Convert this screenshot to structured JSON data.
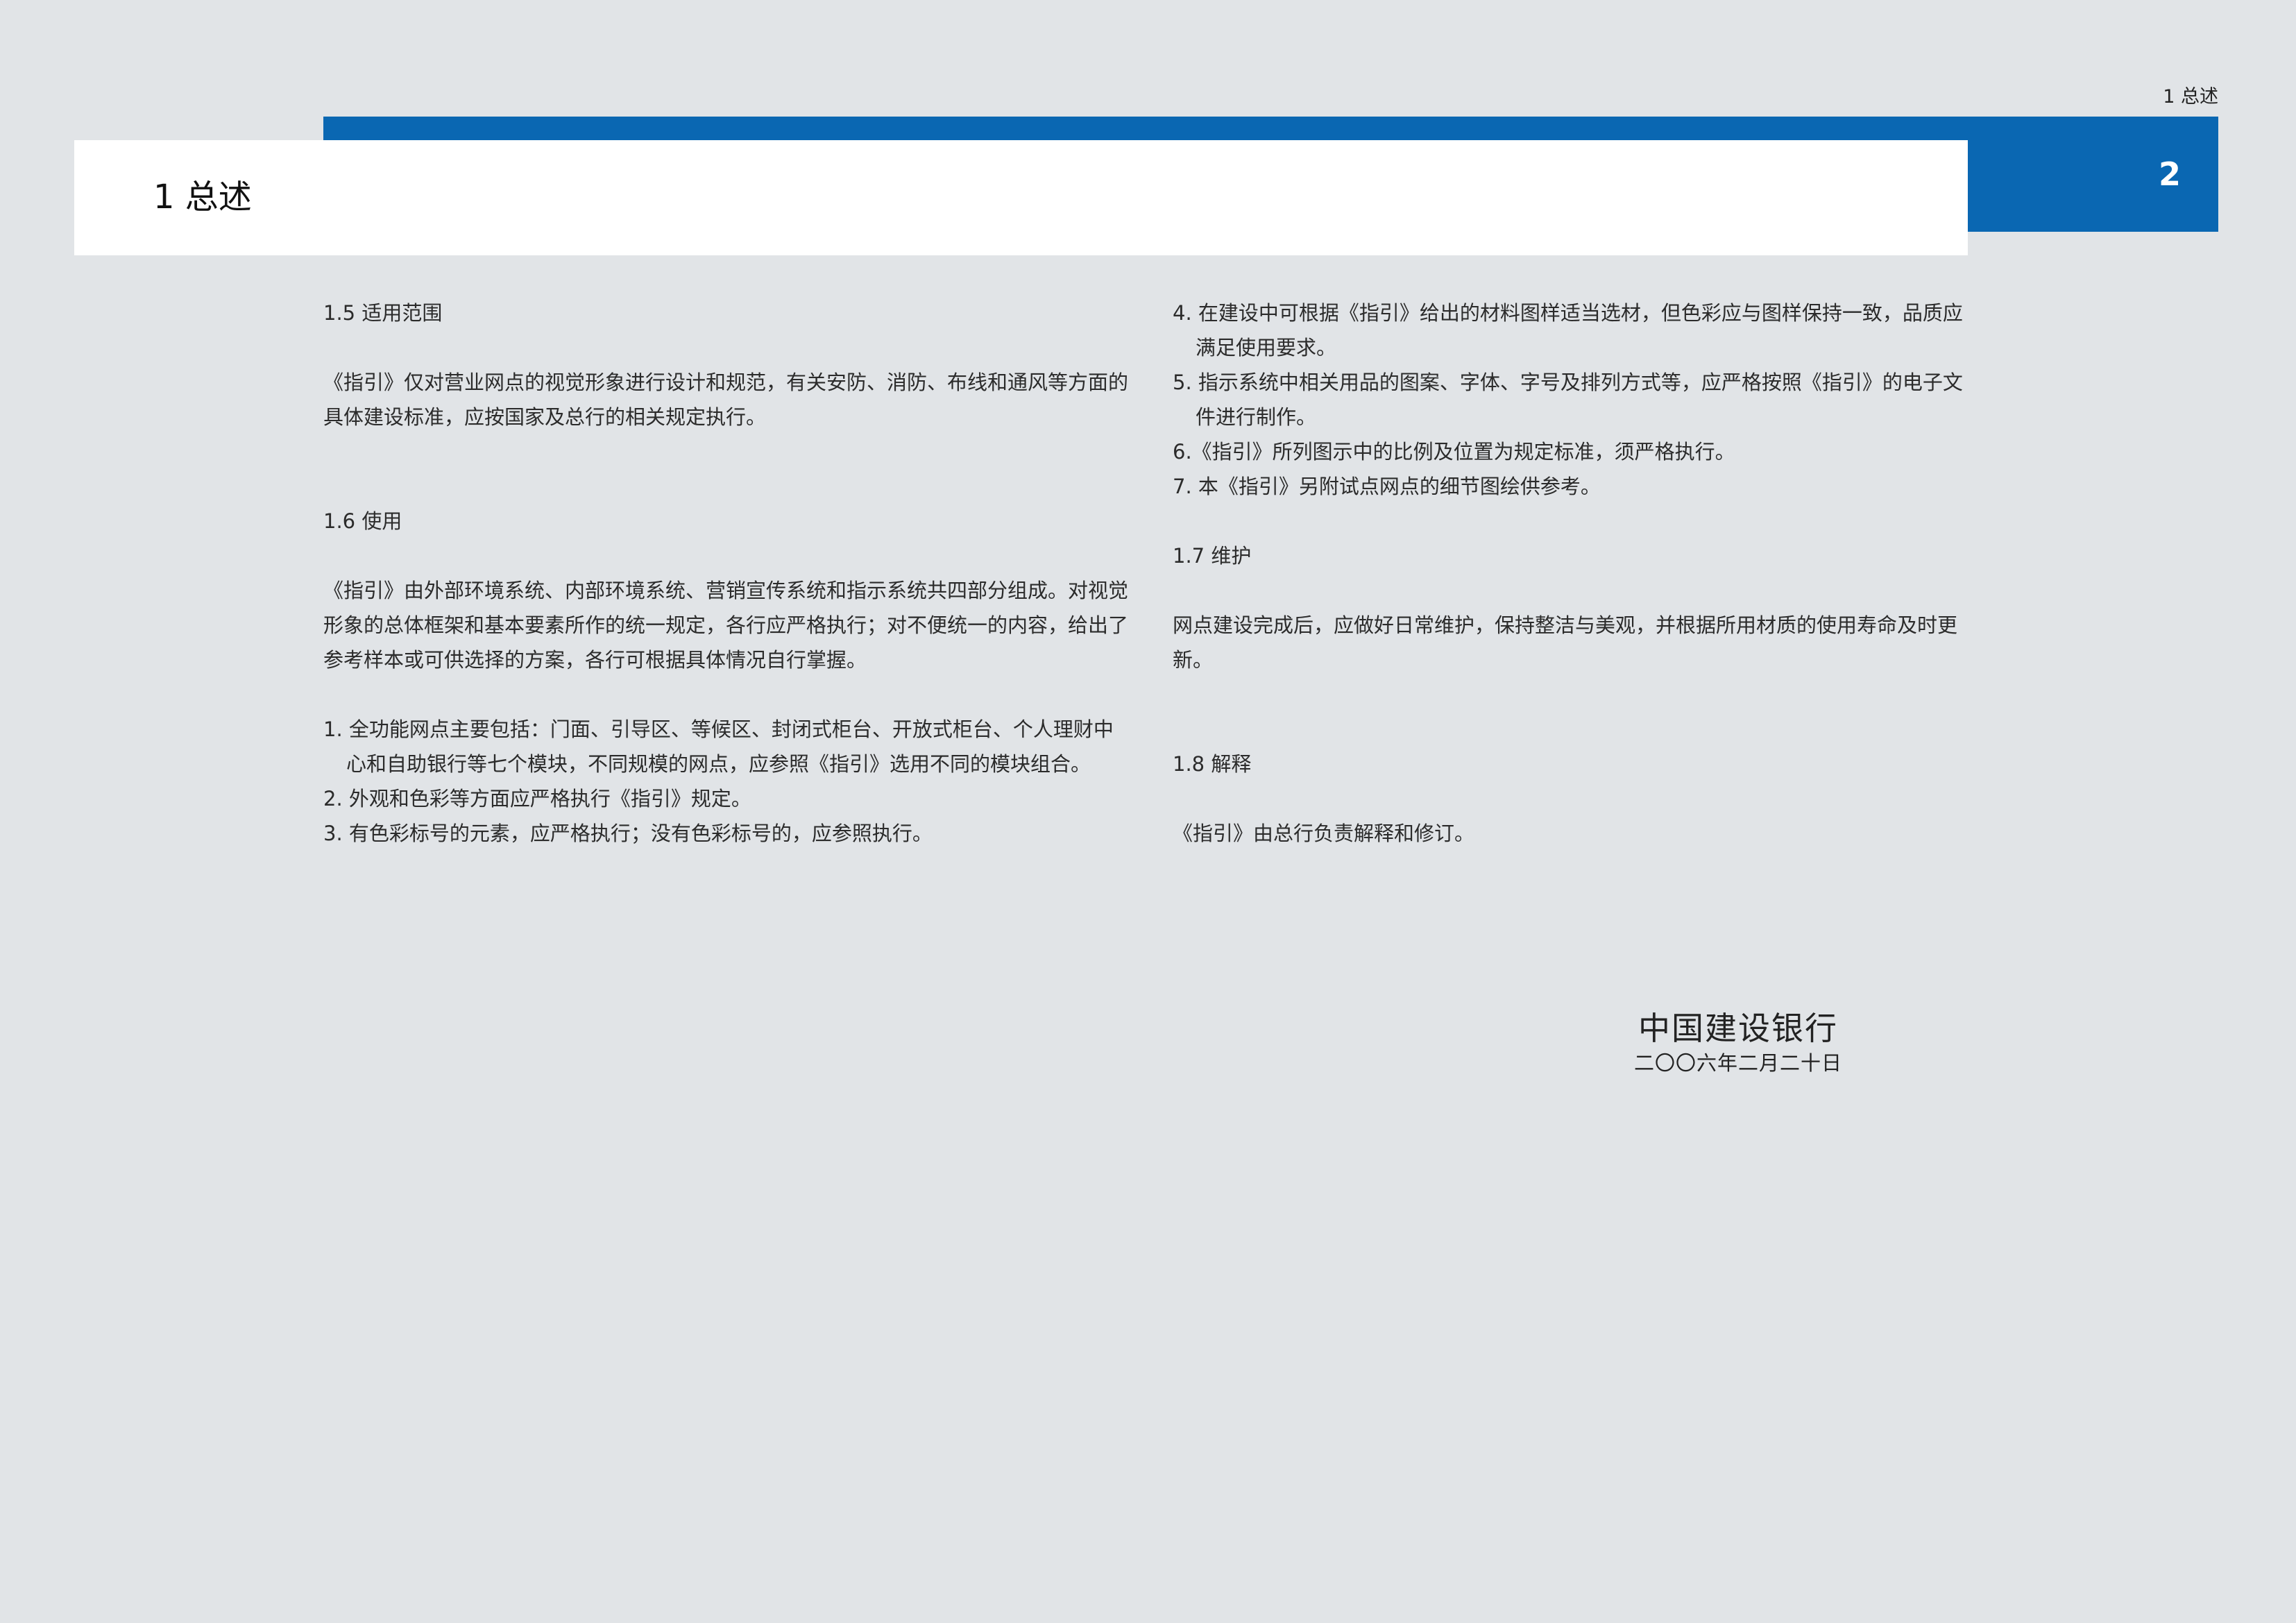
{
  "header": {
    "running_title": "1  总述",
    "page_number": "2",
    "chapter_title": "1 总述"
  },
  "left_column": {
    "s15": {
      "heading": "1.5  适用范围",
      "para": "《指引》仅对营业网点的视觉形象进行设计和规范，有关安防、消防、布线和通风等方面的具体建设标准，应按国家及总行的相关规定执行。"
    },
    "s16": {
      "heading": "1.6  使用",
      "para": "《指引》由外部环境系统、内部环境系统、营销宣传系统和指示系统共四部分组成。对视觉形象的总体框架和基本要素所作的统一规定，各行应严格执行；对不便统一的内容，给出了参考样本或可供选择的方案，各行可根据具体情况自行掌握。",
      "items": [
        "1. 全功能网点主要包括：门面、引导区、等候区、封闭式柜台、开放式柜台、个人理财中心和自助银行等七个模块，不同规模的网点，应参照《指引》选用不同的模块组合。",
        "2. 外观和色彩等方面应严格执行《指引》规定。",
        "3. 有色彩标号的元素，应严格执行；没有色彩标号的，应参照执行。"
      ]
    }
  },
  "right_column": {
    "items": [
      "4. 在建设中可根据《指引》给出的材料图样适当选材，但色彩应与图样保持一致，品质应满足使用要求。",
      "5. 指示系统中相关用品的图案、字体、字号及排列方式等，应严格按照《指引》的电子文件进行制作。",
      "6.《指引》所列图示中的比例及位置为规定标准，须严格执行。",
      "7. 本《指引》另附试点网点的细节图绘供参考。"
    ],
    "s17": {
      "heading": "1.7  维护",
      "para": "网点建设完成后，应做好日常维护，保持整洁与美观，并根据所用材质的使用寿命及时更新。"
    },
    "s18": {
      "heading": "1.8  解释",
      "para": "《指引》由总行负责解释和修订。"
    }
  },
  "signature": {
    "organization": "中国建设银行",
    "date": "二〇〇六年二月二十日"
  },
  "colors": {
    "brand_blue": "#0a67b2",
    "page_background": "#e1e4e7",
    "panel_white": "#ffffff"
  }
}
